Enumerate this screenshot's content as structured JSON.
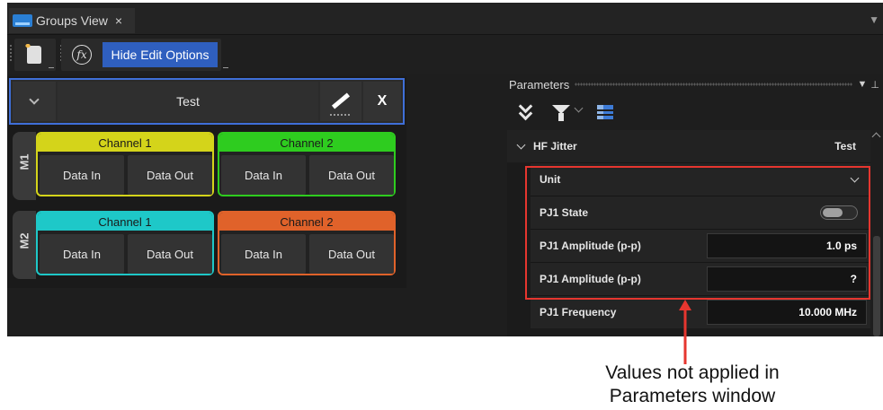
{
  "tab": {
    "title": "Groups View",
    "close": "×"
  },
  "toolbar": {
    "fx_label": "fx",
    "hide_edit_label": "Hide Edit Options"
  },
  "group": {
    "title": "Test",
    "close_label": "X"
  },
  "rows": [
    {
      "label": "M1",
      "channels": [
        {
          "name": "Channel 1",
          "color": "#d4d41a",
          "in_label": "Data In",
          "out_label": "Data Out"
        },
        {
          "name": "Channel 2",
          "color": "#2ecc1f",
          "in_label": "Data In",
          "out_label": "Data Out"
        }
      ]
    },
    {
      "label": "M2",
      "channels": [
        {
          "name": "Channel 1",
          "color": "#1ec8c8",
          "in_label": "Data In",
          "out_label": "Data Out"
        },
        {
          "name": "Channel 2",
          "color": "#e0622a",
          "in_label": "Data In",
          "out_label": "Data Out"
        }
      ]
    }
  ],
  "parameters": {
    "title": "Parameters",
    "section": {
      "name": "HF Jitter",
      "value": "Test"
    },
    "rows": [
      {
        "label": "Unit",
        "value": "",
        "kind": "dropdown"
      },
      {
        "label": "PJ1 State",
        "value": "",
        "kind": "toggle"
      },
      {
        "label": "PJ1 Amplitude (p-p)",
        "value": "1.0 ps",
        "kind": "box"
      },
      {
        "label": "PJ1 Amplitude (p-p)",
        "value": "?",
        "kind": "box"
      },
      {
        "label": "PJ1 Frequency",
        "value": "10.000 MHz",
        "kind": "box"
      }
    ]
  },
  "annotation": {
    "line1": "Values not applied in",
    "line2": "Parameters window",
    "color": "#e6362f"
  }
}
